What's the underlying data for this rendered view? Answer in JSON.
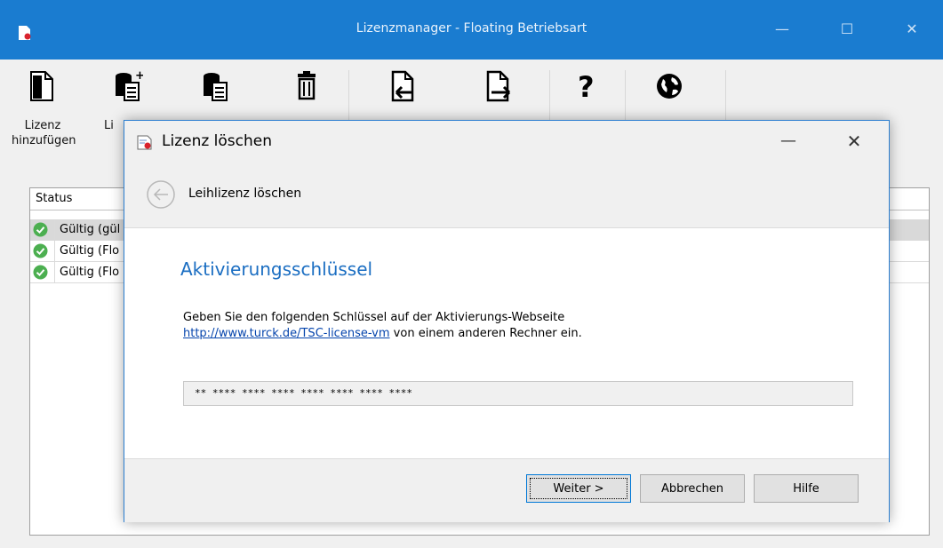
{
  "window": {
    "title": "Lizenzmanager - Floating Betriebsart",
    "minimize_glyph": "—",
    "maximize_glyph": "☐",
    "close_glyph": "✕"
  },
  "toolbar": {
    "buttons": [
      {
        "icon": "add-license-icon",
        "label_line1": "Lizenz",
        "label_line2": "hinzufügen"
      },
      {
        "icon": "license-stack-add-icon",
        "label_line1": "Li",
        "label_line2": ""
      },
      {
        "icon": "license-stack-icon",
        "label_line1": "",
        "label_line2": ""
      },
      {
        "icon": "trash-icon",
        "label_line1": "",
        "label_line2": ""
      },
      {
        "icon": "import-icon",
        "label_line1": "",
        "label_line2": ""
      },
      {
        "icon": "export-icon",
        "label_line1": "",
        "label_line2": ""
      },
      {
        "icon": "help-icon",
        "label_line1": "",
        "label_line2": ""
      },
      {
        "icon": "globe-icon",
        "label_line1": "",
        "label_line2": ""
      }
    ]
  },
  "grid": {
    "column_status": "Status",
    "rows": [
      {
        "status": "Gültig (gül"
      },
      {
        "status": "Gültig (Flo"
      },
      {
        "status": "Gültig (Flo"
      }
    ]
  },
  "dialog": {
    "title": "Lizenz löschen",
    "minimize_glyph": "—",
    "close_glyph": "✕",
    "nav_title": "Leihlizenz löschen",
    "heading": "Aktivierungsschlüssel",
    "desc_line1": "Geben Sie den folgenden Schlüssel auf der Aktivierungs-Webseite",
    "link_text": "http://www.turck.de/TSC-license-vm",
    "desc_line2_rest": " von einem anderen Rechner ein.",
    "key_value": "** **** **** **** **** **** **** ****",
    "buttons": {
      "next": "Weiter >",
      "cancel": "Abbrechen",
      "help": "Hilfe"
    }
  },
  "colors": {
    "titlebar": "#1a7cd0",
    "heading": "#1b6ec2",
    "link": "#0645ad"
  }
}
